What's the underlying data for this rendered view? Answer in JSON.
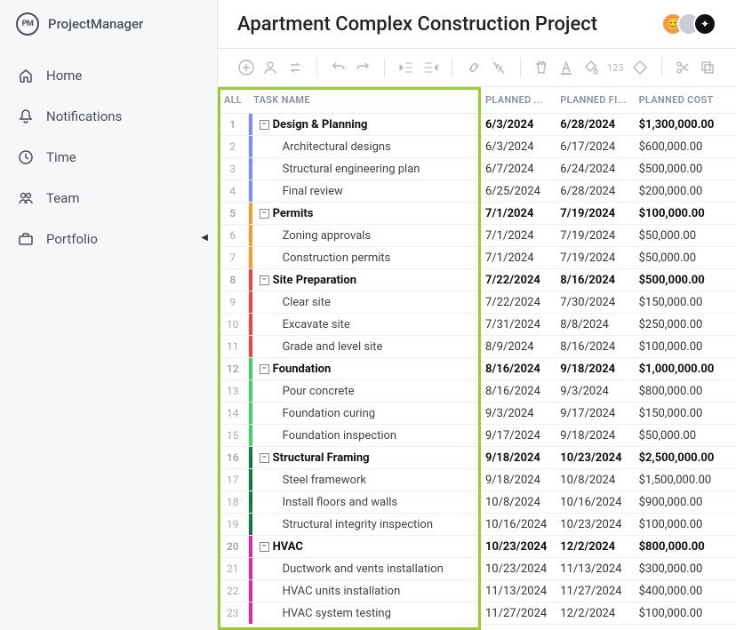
{
  "brand": {
    "abbr": "PM",
    "name": "ProjectManager"
  },
  "nav": [
    {
      "icon": "home-icon",
      "label": "Home"
    },
    {
      "icon": "bell-icon",
      "label": "Notifications"
    },
    {
      "icon": "clock-icon",
      "label": "Time"
    },
    {
      "icon": "team-icon",
      "label": "Team"
    },
    {
      "icon": "briefcase-icon",
      "label": "Portfolio"
    }
  ],
  "project": {
    "title": "Apartment Complex Construction Project"
  },
  "columns": {
    "all": "ALL",
    "name": "TASK NAME",
    "start": "PLANNED ...",
    "finish": "PLANNED FI...",
    "cost": "PLANNED COST"
  },
  "tasks": [
    {
      "n": 1,
      "parent": true,
      "color": "#7b8df8",
      "name": "Design & Planning",
      "start": "6/3/2024",
      "finish": "6/28/2024",
      "cost": "$1,300,000.00"
    },
    {
      "n": 2,
      "parent": false,
      "color": "#7b8df8",
      "name": "Architectural designs",
      "start": "6/3/2024",
      "finish": "6/17/2024",
      "cost": "$600,000.00"
    },
    {
      "n": 3,
      "parent": false,
      "color": "#7b8df8",
      "name": "Structural engineering plan",
      "start": "6/7/2024",
      "finish": "6/24/2024",
      "cost": "$500,000.00"
    },
    {
      "n": 4,
      "parent": false,
      "color": "#7b8df8",
      "name": "Final review",
      "start": "6/25/2024",
      "finish": "6/28/2024",
      "cost": "$200,000.00"
    },
    {
      "n": 5,
      "parent": true,
      "color": "#f0a030",
      "name": "Permits",
      "start": "7/1/2024",
      "finish": "7/19/2024",
      "cost": "$100,000.00"
    },
    {
      "n": 6,
      "parent": false,
      "color": "#f0a030",
      "name": "Zoning approvals",
      "start": "7/1/2024",
      "finish": "7/19/2024",
      "cost": "$50,000.00"
    },
    {
      "n": 7,
      "parent": false,
      "color": "#f0a030",
      "name": "Construction permits",
      "start": "7/1/2024",
      "finish": "7/19/2024",
      "cost": "$50,000.00"
    },
    {
      "n": 8,
      "parent": true,
      "color": "#ef4444",
      "name": "Site Preparation",
      "start": "7/22/2024",
      "finish": "8/16/2024",
      "cost": "$500,000.00"
    },
    {
      "n": 9,
      "parent": false,
      "color": "#ef4444",
      "name": "Clear site",
      "start": "7/22/2024",
      "finish": "7/30/2024",
      "cost": "$150,000.00"
    },
    {
      "n": 10,
      "parent": false,
      "color": "#ef4444",
      "name": "Excavate site",
      "start": "7/31/2024",
      "finish": "8/8/2024",
      "cost": "$250,000.00"
    },
    {
      "n": 11,
      "parent": false,
      "color": "#ef4444",
      "name": "Grade and level site",
      "start": "8/9/2024",
      "finish": "8/16/2024",
      "cost": "$100,000.00"
    },
    {
      "n": 12,
      "parent": true,
      "color": "#3fd06a",
      "name": "Foundation",
      "start": "8/16/2024",
      "finish": "9/18/2024",
      "cost": "$1,000,000.00"
    },
    {
      "n": 13,
      "parent": false,
      "color": "#3fd06a",
      "name": "Pour concrete",
      "start": "8/16/2024",
      "finish": "9/3/2024",
      "cost": "$800,000.00"
    },
    {
      "n": 14,
      "parent": false,
      "color": "#3fd06a",
      "name": "Foundation curing",
      "start": "9/3/2024",
      "finish": "9/17/2024",
      "cost": "$150,000.00"
    },
    {
      "n": 15,
      "parent": false,
      "color": "#3fd06a",
      "name": "Foundation inspection",
      "start": "9/17/2024",
      "finish": "9/18/2024",
      "cost": "$50,000.00"
    },
    {
      "n": 16,
      "parent": true,
      "color": "#0a7d3e",
      "name": "Structural Framing",
      "start": "9/18/2024",
      "finish": "10/23/2024",
      "cost": "$2,500,000.00"
    },
    {
      "n": 17,
      "parent": false,
      "color": "#0a7d3e",
      "name": "Steel framework",
      "start": "9/18/2024",
      "finish": "10/8/2024",
      "cost": "$1,500,000.00"
    },
    {
      "n": 18,
      "parent": false,
      "color": "#0a7d3e",
      "name": "Install floors and walls",
      "start": "10/8/2024",
      "finish": "10/16/2024",
      "cost": "$900,000.00"
    },
    {
      "n": 19,
      "parent": false,
      "color": "#0a7d3e",
      "name": "Structural integrity inspection",
      "start": "10/16/2024",
      "finish": "10/23/2024",
      "cost": "$100,000.00"
    },
    {
      "n": 20,
      "parent": true,
      "color": "#e0299a",
      "name": "HVAC",
      "start": "10/23/2024",
      "finish": "12/2/2024",
      "cost": "$800,000.00"
    },
    {
      "n": 21,
      "parent": false,
      "color": "#e0299a",
      "name": "Ductwork and vents installation",
      "start": "10/23/2024",
      "finish": "11/13/2024",
      "cost": "$300,000.00"
    },
    {
      "n": 22,
      "parent": false,
      "color": "#e0299a",
      "name": "HVAC units installation",
      "start": "11/13/2024",
      "finish": "11/27/2024",
      "cost": "$400,000.00"
    },
    {
      "n": 23,
      "parent": false,
      "color": "#e0299a",
      "name": "HVAC system testing",
      "start": "11/27/2024",
      "finish": "12/2/2024",
      "cost": "$100,000.00"
    }
  ]
}
